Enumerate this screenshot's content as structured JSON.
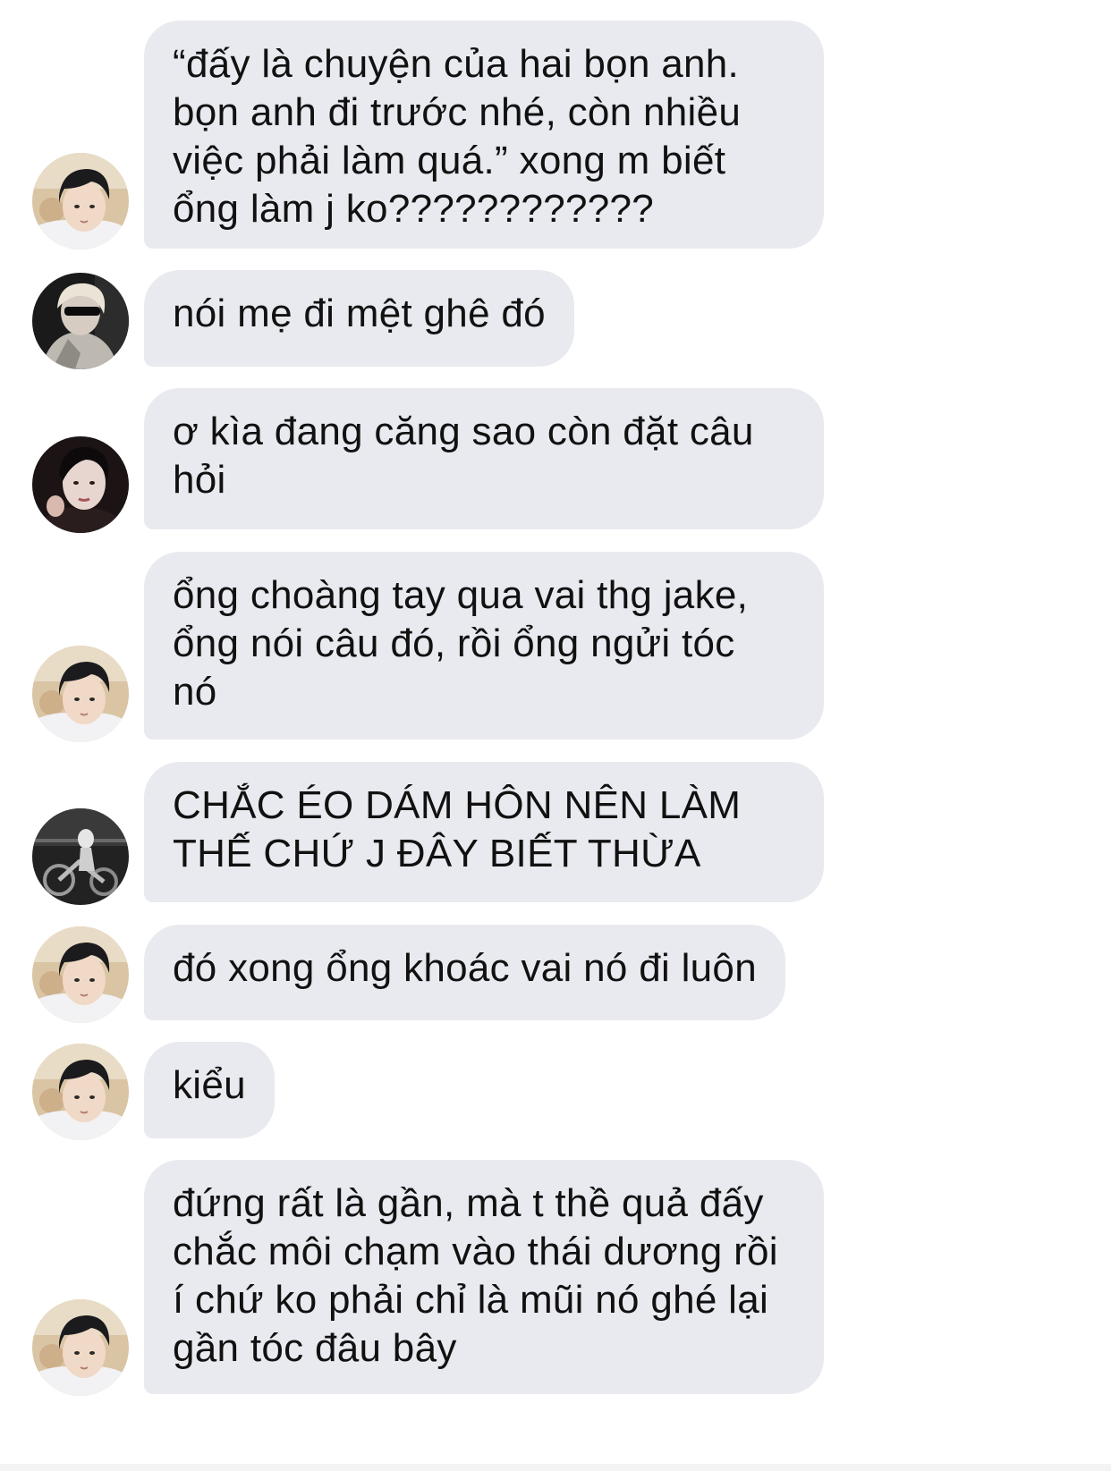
{
  "messages": [
    {
      "avatar": "beach-boy-avatar",
      "lines": [
        "“đấy là chuyện của hai bọn anh.",
        "bọn anh đi trước nhé, còn nhiều",
        "việc phải làm quá.” xong m biết",
        "ổng làm j ko????????????"
      ]
    },
    {
      "avatar": "blond-sunglasses-avatar",
      "lines": [
        "nói mẹ đi mệt ghê đó"
      ]
    },
    {
      "avatar": "dark-portrait-avatar",
      "lines": [
        "ơ kìa đang căng sao còn đặt câu",
        "hỏi"
      ]
    },
    {
      "avatar": "beach-boy-avatar",
      "lines": [
        "ổng choàng tay qua vai thg jake,",
        "ổng nói câu đó, rồi ổng ngửi tóc",
        "nó"
      ]
    },
    {
      "avatar": "motorcycle-avatar",
      "lines": [
        "CHẮC ÉO DÁM HÔN NÊN LÀM",
        "THẾ CHỨ J ĐÂY BIẾT THỪA"
      ]
    },
    {
      "avatar": "beach-boy-avatar",
      "lines": [
        "đó xong ổng khoác vai nó đi luôn"
      ]
    },
    {
      "avatar": "beach-boy-avatar",
      "lines": [
        "kiểu"
      ]
    },
    {
      "avatar": "beach-boy-avatar",
      "lines": [
        "đứng rất là gần, mà t thề quả đấy",
        "chắc môi chạm vào thái dương rồi",
        "í chứ ko phải chỉ là mũi nó ghé lại",
        "gần tóc đâu bây"
      ]
    }
  ],
  "colors": {
    "bubble": "#e9eaef",
    "text": "#111111",
    "background": "#ffffff"
  }
}
